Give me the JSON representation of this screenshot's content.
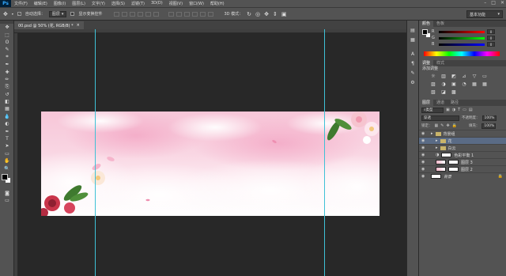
{
  "app": {
    "logo": "Ps"
  },
  "menu": [
    "文件(F)",
    "编辑(E)",
    "图像(I)",
    "图层(L)",
    "文字(Y)",
    "选择(S)",
    "滤镜(T)",
    "3D(D)",
    "视图(V)",
    "窗口(W)",
    "帮助(H)"
  ],
  "window_controls": [
    "–",
    "□",
    "✕"
  ],
  "options": {
    "auto_select_label": "自动选择：",
    "auto_select_value": "图层",
    "show_transform_label": "显示变换控件",
    "mode_3d_label": "3D 模式：",
    "workspace": "基本功能"
  },
  "document": {
    "tab_title": "00.psd @ 50% (花, RGB/8) *",
    "close": "×"
  },
  "tools": [
    "move-tool",
    "marquee-tool",
    "lasso-tool",
    "quick-select-tool",
    "crop-tool",
    "eyedropper-tool",
    "healing-tool",
    "brush-tool",
    "stamp-tool",
    "history-brush-tool",
    "eraser-tool",
    "gradient-tool",
    "blur-tool",
    "dodge-tool",
    "pen-tool",
    "type-tool",
    "path-select-tool",
    "shape-tool",
    "hand-tool",
    "zoom-tool"
  ],
  "tool_glyphs": [
    "✥",
    "⬚",
    "ʘ",
    "✎",
    "⌗",
    "✒",
    "✚",
    "✏",
    "⎘",
    "↺",
    "◧",
    "▦",
    "💧",
    "◐",
    "✒",
    "T",
    "➤",
    "▭",
    "✋",
    "🔍"
  ],
  "color_panel": {
    "tabs": [
      "颜色",
      "色板"
    ],
    "channels": [
      {
        "label": "R",
        "value": "0",
        "color": "#ff0000"
      },
      {
        "label": "G",
        "value": "0",
        "color": "#00ff00"
      },
      {
        "label": "B",
        "value": "0",
        "color": "#0000ff"
      }
    ]
  },
  "adjust_panel": {
    "tabs": [
      "调整",
      "样式"
    ],
    "title": "添加调整",
    "icons": [
      "☼",
      "▥",
      "◩",
      "⊿",
      "▽",
      "▭",
      "▨",
      "◑",
      "▣",
      "◔",
      "▦",
      "▦",
      "▧",
      "◪",
      "▩"
    ]
  },
  "layers_panel": {
    "tabs": [
      "图层",
      "通道",
      "路径"
    ],
    "filter_label": "类型",
    "blend_mode": "穿透",
    "opacity_label": "不透明度：",
    "opacity": "100%",
    "lock_label": "锁定：",
    "fill_label": "填充：",
    "fill": "100%",
    "layers": [
      {
        "name": "背景组",
        "kind": "group",
        "indent": 0,
        "selected": false
      },
      {
        "name": "花",
        "kind": "group",
        "indent": 1,
        "selected": true
      },
      {
        "name": "白云",
        "kind": "group",
        "indent": 1,
        "selected": false
      },
      {
        "name": "色彩平衡 1",
        "kind": "adjust",
        "indent": 1,
        "selected": false
      },
      {
        "name": "图层 3",
        "kind": "layer",
        "indent": 1,
        "selected": false
      },
      {
        "name": "图层 2",
        "kind": "layer",
        "indent": 1,
        "selected": false
      },
      {
        "name": "背景",
        "kind": "background",
        "indent": 0,
        "selected": false
      }
    ]
  }
}
